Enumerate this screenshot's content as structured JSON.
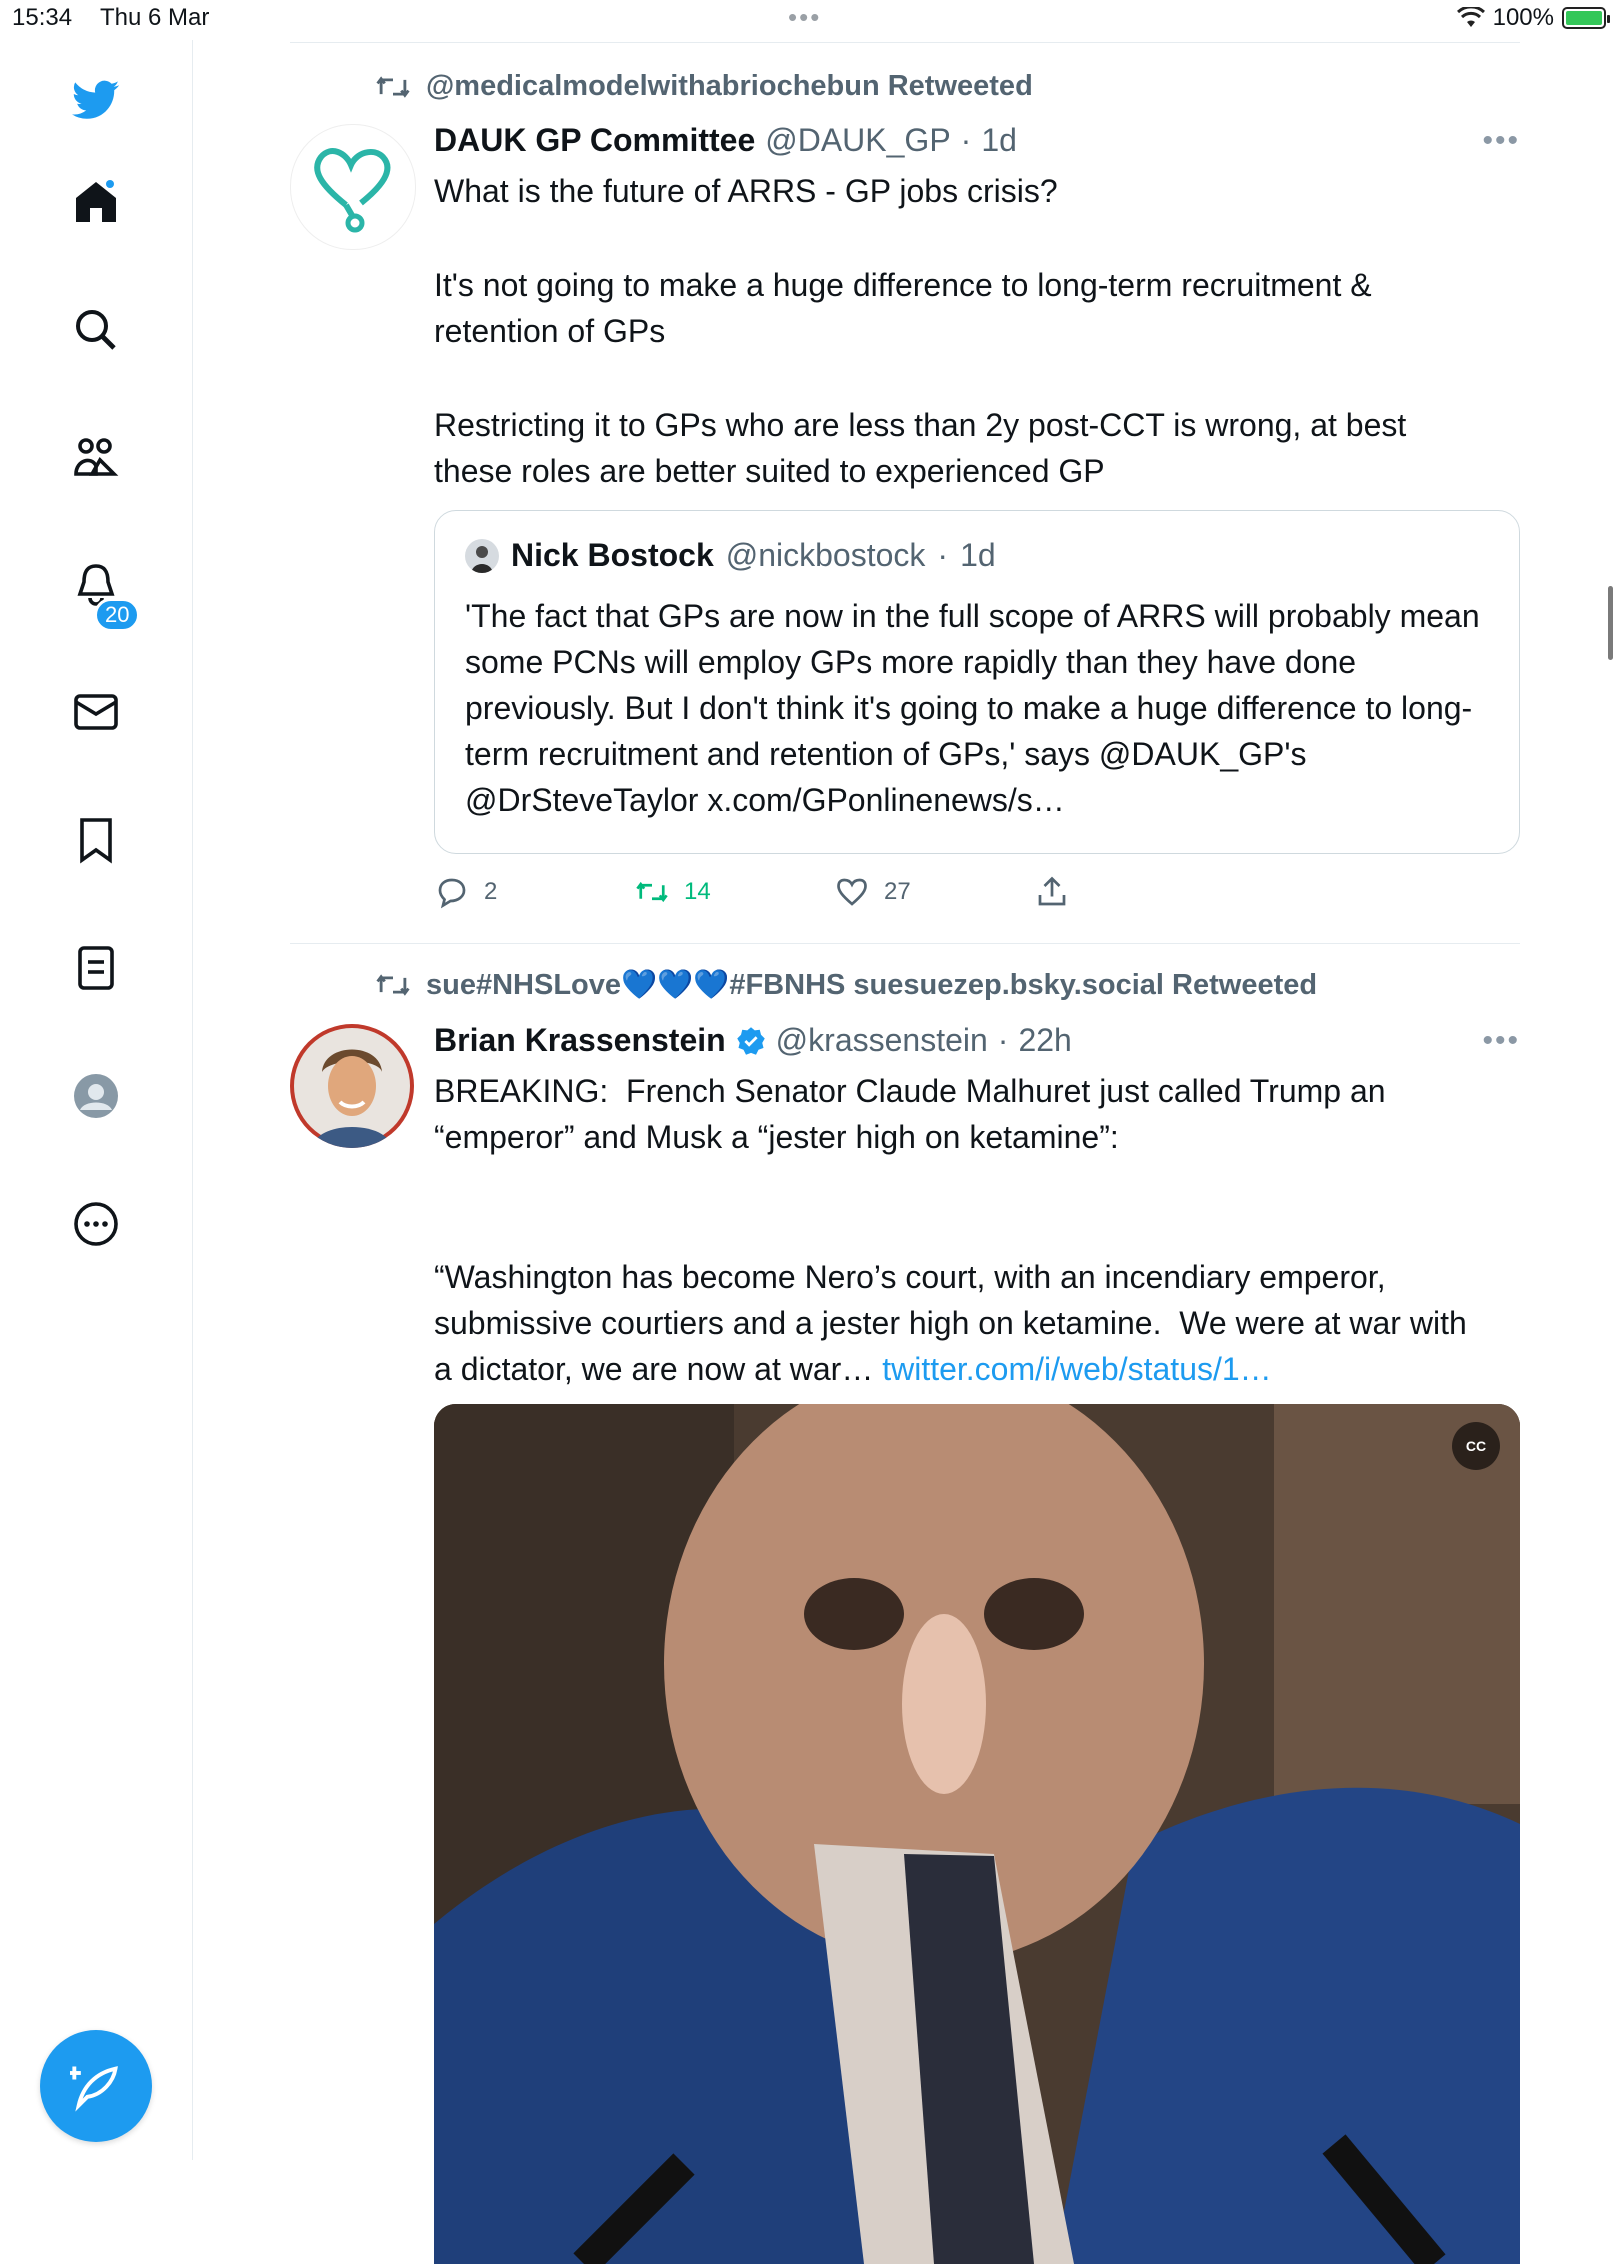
{
  "status_bar": {
    "time": "15:34",
    "date": "Thu 6 Mar",
    "dots": "•••",
    "battery_text": "100%",
    "battery_level": 1.0
  },
  "sidebar": {
    "items": [
      {
        "name": "twitter-logo-icon"
      },
      {
        "name": "home-icon"
      },
      {
        "name": "search-icon"
      },
      {
        "name": "communities-icon"
      },
      {
        "name": "notifications-icon"
      },
      {
        "name": "messages-icon"
      },
      {
        "name": "bookmarks-icon"
      },
      {
        "name": "lists-icon"
      },
      {
        "name": "profile-icon"
      },
      {
        "name": "more-icon"
      }
    ],
    "notification_count": "20",
    "accent_color": "#1d9bf0"
  },
  "tweets": [
    {
      "retweeted_by": "@medicalmodelwithabriochebun Retweeted",
      "name": "DAUK GP Committee",
      "handle": "@DAUK_GP",
      "sep": "·",
      "time": "1d",
      "text_1": "What is the future of ARRS - GP jobs crisis?",
      "text_2": "It's not going to make a huge difference to long-term recruitment & retention of GPs",
      "text_3": "Restricting it to GPs who are less than 2y post-CCT is wrong, at best these roles are better suited to experienced GP",
      "quote": {
        "name": "Nick Bostock",
        "handle": "@nickbostock",
        "sep": "·",
        "time": "1d",
        "text": "'The fact that GPs are now in the full scope of ARRS will probably mean some PCNs will employ GPs more rapidly than they have done previously. But I don't think it's going to make a huge difference to long-term recruitment and retention of GPs,' says @DAUK_GP's @DrSteveTaylor x.com/GPonlinenews/s…"
      },
      "replies": "2",
      "retweets": "14",
      "likes": "27"
    },
    {
      "retweeted_by": "sue#NHSLove💙💙💙#FBNHS suesuezep.bsky.social Retweeted",
      "name": "Brian Krassenstein",
      "handle": "@krassenstein",
      "sep": "·",
      "time": "22h",
      "text_1": "BREAKING:  French Senator Claude Malhuret just called Trump an “emperor” and Musk a “jester high on ketamine”:",
      "text_2": "“Washington has become Nero’s court, with an incendiary emperor, submissive courtiers and a jester high on ketamine.  We were at war with a dictator, we are now at war… ",
      "link": "twitter.com/i/web/status/1…",
      "cc_label": "CC"
    }
  ],
  "colors": {
    "retweet_green": "#00ba7c",
    "secondary_text": "#536471",
    "border": "#cfd9de"
  }
}
